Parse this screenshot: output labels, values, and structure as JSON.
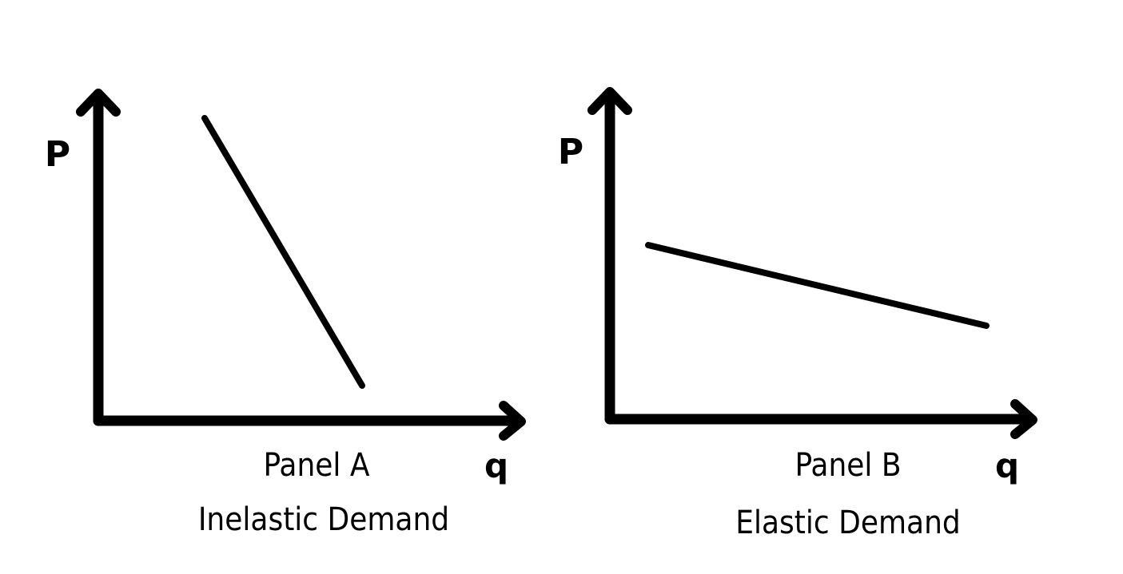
{
  "colors": {
    "background": "#ffffff",
    "ink": "#000000"
  },
  "panels": [
    {
      "id": "panel-a",
      "y_axis_label": "P",
      "x_axis_label": "q",
      "caption_line1": "Panel A",
      "caption_line2": "Inelastic Demand",
      "demand_slope": "steep"
    },
    {
      "id": "panel-b",
      "y_axis_label": "P",
      "x_axis_label": "q",
      "caption_line1": "Panel B",
      "caption_line2": "Elastic Demand",
      "demand_slope": "flat"
    }
  ]
}
